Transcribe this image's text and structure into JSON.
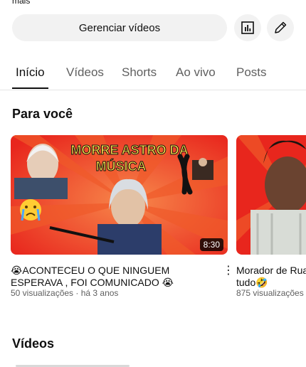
{
  "header": {
    "cut_text": "mais"
  },
  "actions": {
    "manage_label": "Gerenciar vídeos",
    "analytics_icon": "analytics-icon",
    "edit_icon": "pencil-icon"
  },
  "tabs": [
    {
      "label": "Início",
      "active": true
    },
    {
      "label": "Vídeos"
    },
    {
      "label": "Shorts"
    },
    {
      "label": "Ao vivo"
    },
    {
      "label": "Posts"
    }
  ],
  "sections": {
    "for_you": "Para você",
    "videos": "Vídeos"
  },
  "videos": [
    {
      "thumb_text_1": "MORRE ASTRO DA",
      "thumb_text_2": "MÚSICA",
      "duration": "8:30",
      "title_line1": "😭ACONTECEU O QUE NINGUEM",
      "title_line2": "ESPERAVA , FOI COMUNICADO 😭",
      "meta": "50 visualizações · há 3 anos"
    },
    {
      "title_line1": "Morador de Rua",
      "title_line2": "tudo🤣",
      "meta": "875 visualizações"
    }
  ],
  "colors": {
    "thumb_red": "#e8261d",
    "thumb_orange": "#f0642a",
    "thumb_yellow": "#ffe14a",
    "chip_bg": "#f2f2f2"
  }
}
